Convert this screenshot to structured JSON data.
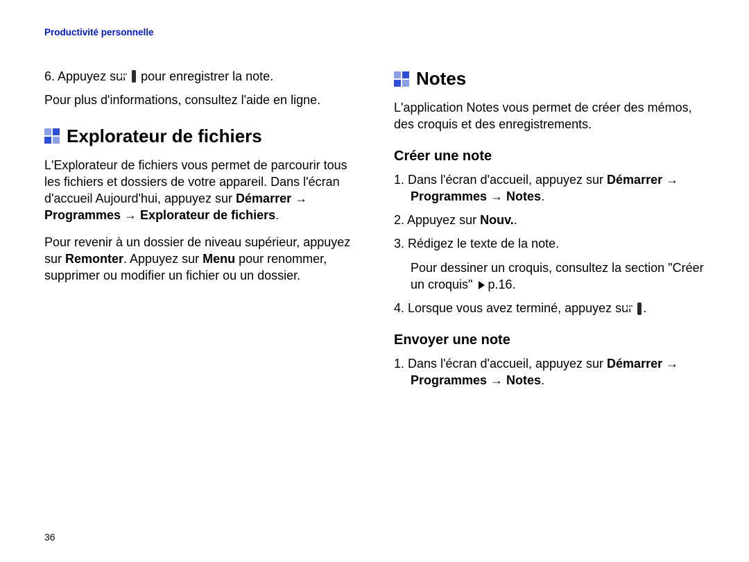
{
  "header": {
    "breadcrumb": "Productivité personnelle"
  },
  "left": {
    "step6_a": "6. Appuyez sur ",
    "ok": "ok",
    "step6_b": " pour enregistrer la note.",
    "moreinfo": "Pour plus d'informations, consultez l'aide en ligne.",
    "h_explorer": "Explorateur de fichiers",
    "explorer_p1_a": "L'Explorateur de fichiers vous permet de parcourir tous les fichiers et dossiers de votre appareil. Dans l'écran d'accueil Aujourd'hui, appuyez sur ",
    "explorer_p1_b": "Démarrer → Programmes → Explorateur de fichiers",
    "explorer_p2_a": "Pour revenir à un dossier de niveau supérieur, appuyez sur ",
    "explorer_p2_b": "Remonter",
    "explorer_p2_c": ". Appuyez sur ",
    "explorer_p2_d": "Menu",
    "explorer_p2_e": " pour renommer, supprimer ou modifier un fichier ou un dossier."
  },
  "right": {
    "h_notes": "Notes",
    "notes_intro": "L'application Notes vous permet de créer des mémos, des croquis et des enregistrements.",
    "h_create": "Créer une note",
    "c1_a": "1. Dans l'écran d'accueil, appuyez sur ",
    "c1_b": "Démarrer → Programmes → Notes",
    "c2_a": "2. Appuyez sur ",
    "c2_b": "Nouv.",
    "c3": "3. Rédigez le texte de la note.",
    "c3b_a": "Pour dessiner un croquis, consultez la section \"Créer un croquis\" ",
    "c3b_ref": "p.16.",
    "c4_a": "4. Lorsque vous avez terminé, appuyez sur ",
    "h_send": "Envoyer une note",
    "s1_a": "1. Dans l'écran d'accueil, appuyez sur ",
    "s1_b": "Démarrer → Programmes → Notes"
  },
  "page_number": "36"
}
